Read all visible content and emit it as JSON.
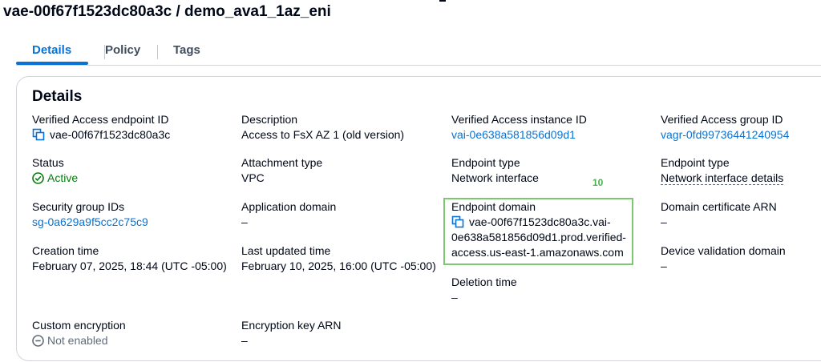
{
  "page": {
    "title": "vae-00f67f1523dc80a3c / demo_ava1_1az_eni"
  },
  "tabs": [
    {
      "label": "Details",
      "active": true
    },
    {
      "label": "Policy",
      "active": false
    },
    {
      "label": "Tags",
      "active": false
    }
  ],
  "panel": {
    "heading": "Details"
  },
  "fields": {
    "endpoint_id": {
      "label": "Verified Access endpoint ID",
      "value": "vae-00f67f1523dc80a3c"
    },
    "description": {
      "label": "Description",
      "value": "Access to FsX AZ 1 (old version)"
    },
    "instance_id": {
      "label": "Verified Access instance ID",
      "value": "vai-0e638a581856d09d1"
    },
    "group_id": {
      "label": "Verified Access group ID",
      "value": "vagr-0fd99736441240954"
    },
    "status": {
      "label": "Status",
      "value": "Active"
    },
    "attachment_type": {
      "label": "Attachment type",
      "value": "VPC"
    },
    "endpoint_type_1": {
      "label": "Endpoint type",
      "value": "Network interface"
    },
    "endpoint_type_2": {
      "label": "Endpoint type",
      "value": "Network interface details"
    },
    "security_group_ids": {
      "label": "Security group IDs",
      "value": "sg-0a629a9f5cc2c75c9"
    },
    "application_domain": {
      "label": "Application domain",
      "value": "–"
    },
    "endpoint_domain": {
      "label": "Endpoint domain",
      "line1": "vae-00f67f1523dc80a3c.vai-",
      "line2": "0e638a581856d09d1.prod.verified-",
      "line3": "access.us-east-1.amazonaws.com"
    },
    "domain_cert_arn": {
      "label": "Domain certificate ARN",
      "value": "–"
    },
    "creation_time": {
      "label": "Creation time",
      "value": "February 07, 2025, 18:44 (UTC -05:00)"
    },
    "last_updated_time": {
      "label": "Last updated time",
      "value": "February 10, 2025, 16:00 (UTC -05:00)"
    },
    "device_validation_domain": {
      "label": "Device validation domain",
      "value": "–"
    },
    "deletion_time": {
      "label": "Deletion time",
      "value": "–"
    },
    "custom_encryption": {
      "label": "Custom encryption",
      "value": "Not enabled"
    },
    "encryption_key_arn": {
      "label": "Encryption key ARN",
      "value": "–"
    }
  },
  "annotation": {
    "number": "10"
  },
  "colors": {
    "link": "#0972d3",
    "success": "#037f0c",
    "highlight": "#7bc96f"
  },
  "icons": {
    "copy": "copy-icon",
    "status_active": "check-circle-icon",
    "status_disabled": "minus-circle-icon"
  }
}
